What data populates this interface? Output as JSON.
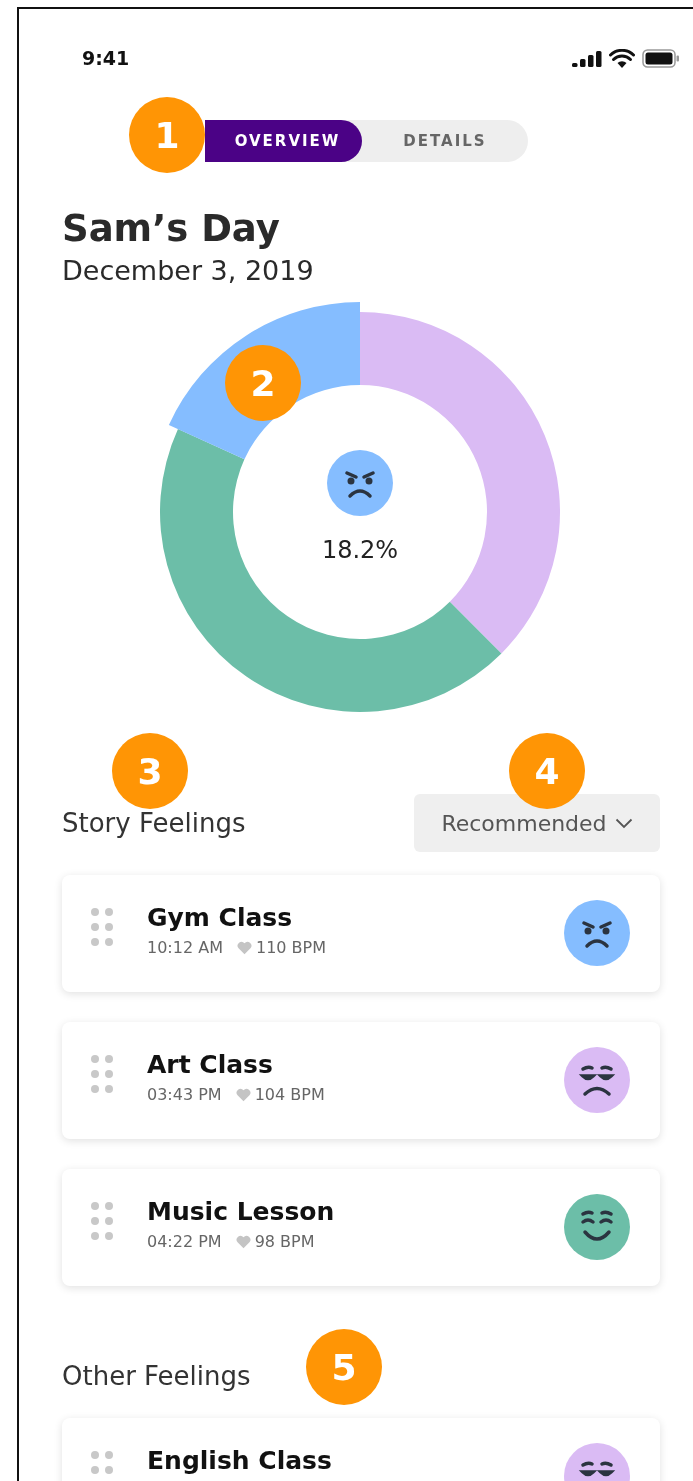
{
  "status_bar": {
    "time": "9:41"
  },
  "tabs": [
    {
      "label": "OVERVIEW",
      "selected": true
    },
    {
      "label": "DETAILS",
      "selected": false
    }
  ],
  "title": "Sam’s Day",
  "date": "December 3, 2019",
  "donut": {
    "segments": [
      {
        "color": "#dabbf4",
        "selected": false
      },
      {
        "color": "#6cbea8",
        "selected": false
      },
      {
        "color": "#85bdff",
        "selected": true
      }
    ],
    "center_face": {
      "kind": "angry",
      "color": "#85bdff"
    },
    "center_value": "18.2%"
  },
  "story_feelings": {
    "heading": "Story Feelings",
    "sort": {
      "label": "Recommended"
    },
    "items": [
      {
        "title": "Gym Class",
        "time": "10:12 AM",
        "heart_rate": "110 BPM",
        "face": {
          "kind": "angry",
          "color": "#85bdff"
        }
      },
      {
        "title": "Art Class",
        "time": "03:43 PM",
        "heart_rate": "104 BPM",
        "face": {
          "kind": "sad",
          "color": "#dabbf4"
        }
      },
      {
        "title": "Music Lesson",
        "time": "04:22 PM",
        "heart_rate": "98 BPM",
        "face": {
          "kind": "happy",
          "color": "#6cbea8"
        }
      }
    ]
  },
  "other_feelings": {
    "heading": "Other Feelings",
    "items": [
      {
        "title": "English Class",
        "face": {
          "kind": "sad",
          "color": "#dabbf4"
        }
      }
    ]
  },
  "markers": [
    {
      "label": "1"
    },
    {
      "label": "2"
    },
    {
      "label": "3"
    },
    {
      "label": "4"
    },
    {
      "label": "5"
    }
  ]
}
